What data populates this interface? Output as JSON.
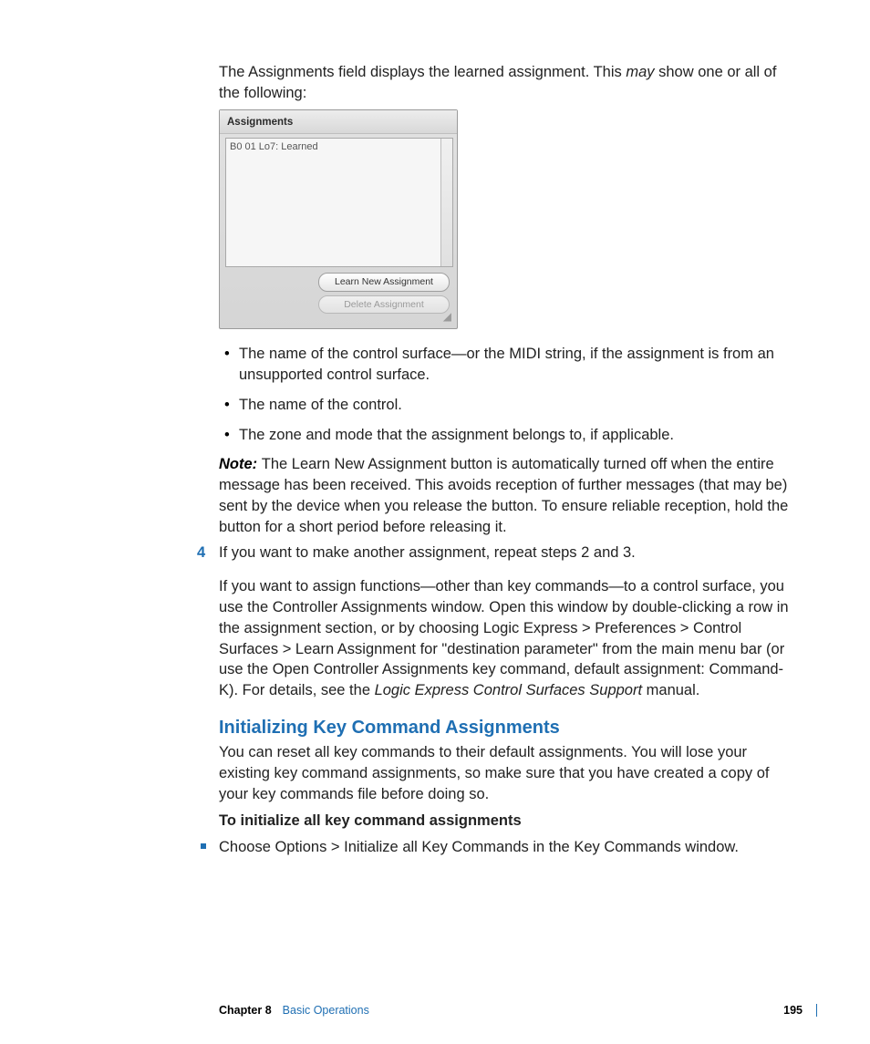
{
  "intro": {
    "part1": "The Assignments field displays the learned assignment. This ",
    "may": "may",
    "part2": " show one or all of the following:"
  },
  "panel": {
    "title": "Assignments",
    "entry": "B0 01 Lo7: Learned",
    "learn_btn": "Learn New Assignment",
    "delete_btn": "Delete Assignment"
  },
  "bullets": [
    "The name of the control surface—or the MIDI string, if the assignment is from an unsupported control surface.",
    "The name of the control.",
    "The zone and mode that the assignment belongs to, if applicable."
  ],
  "note": {
    "label": "Note:  ",
    "text": "The Learn New Assignment button is automatically turned off when the entire message has been received. This avoids reception of further messages (that may be) sent by the device when you release the button. To ensure reliable reception, hold the button for a short period before releasing it."
  },
  "step4": {
    "num": "4",
    "text": "If you want to make another assignment, repeat steps 2 and 3."
  },
  "long_para": {
    "part1": "If you want to assign functions—other than key commands—to a control surface, you use the Controller Assignments window. Open this window by double-clicking a row in the assignment section, or by choosing Logic Express > Preferences > Control Surfaces > Learn Assignment for \"destination parameter\" from the main menu bar (or use the Open Controller Assignments key command, default assignment:  Command-K). For details, see the ",
    "manual": "Logic Express Control Surfaces Support",
    "part2": " manual."
  },
  "section": {
    "title": "Initializing Key Command Assignments",
    "body": "You can reset all key commands to their default assignments. You will lose your existing key command assignments, so make sure that you have created a copy of your key commands file before doing so."
  },
  "procedure": {
    "title": "To initialize all key command assignments",
    "step": "Choose Options > Initialize all Key Commands in the Key Commands window."
  },
  "footer": {
    "chapter_label": "Chapter 8",
    "chapter_title": "Basic Operations",
    "page": "195"
  }
}
